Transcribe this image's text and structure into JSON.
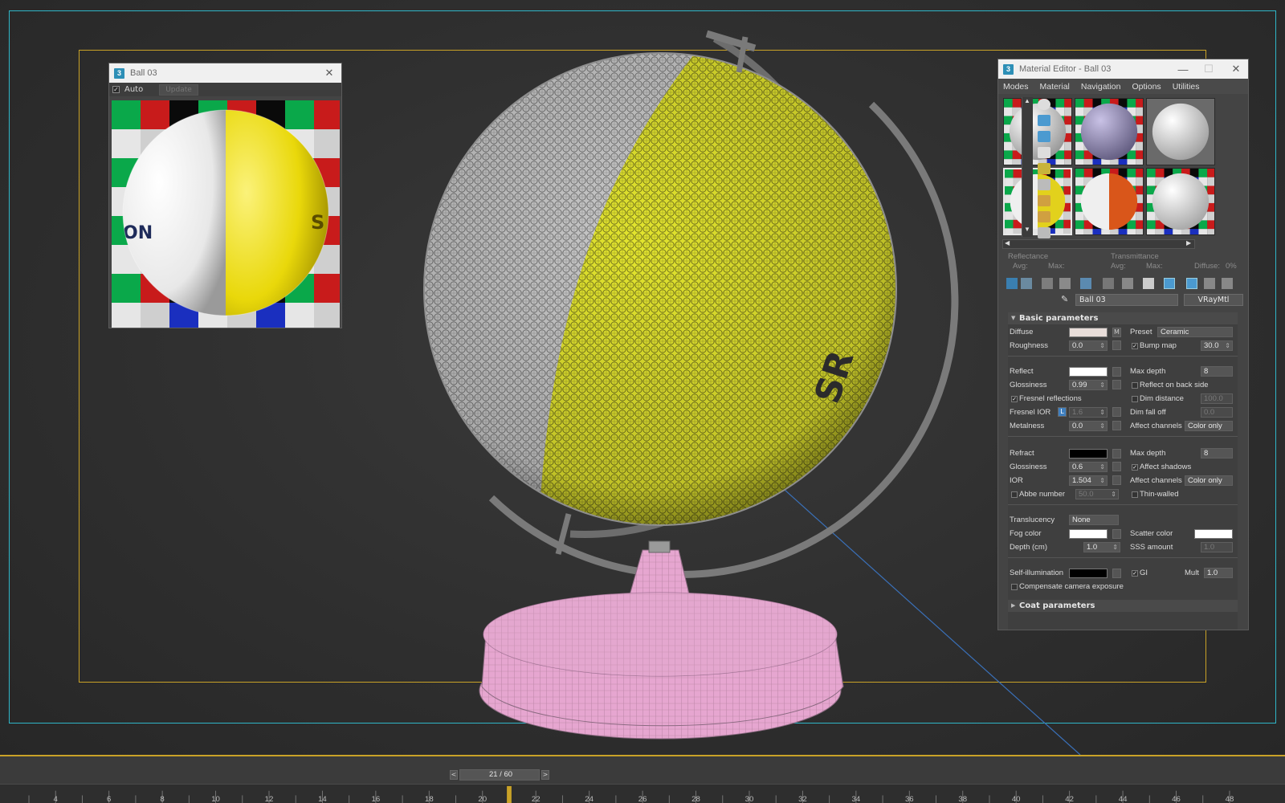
{
  "preview_window": {
    "title": "Ball 03",
    "auto_label": "Auto",
    "auto_checked": true,
    "update_label": "Update"
  },
  "material_editor": {
    "title": "Material Editor - Ball 03",
    "menu": [
      "Modes",
      "Material",
      "Navigation",
      "Options",
      "Utilities"
    ],
    "info": {
      "reflectance": "Reflectance",
      "transmittance": "Transmittance",
      "avg": "Avg:",
      "max": "Max:",
      "diffuse": "Diffuse:",
      "diffuse_value": "0%"
    },
    "material_name": "Ball 03",
    "material_type": "VRayMtl",
    "basic_params_title": "Basic parameters",
    "coat_params_title": "Coat parameters",
    "params": {
      "diffuse": "Diffuse",
      "diffuse_map": "M",
      "preset": "Preset",
      "preset_value": "Ceramic",
      "roughness": "Roughness",
      "roughness_value": "0.0",
      "bump_map": "Bump map",
      "bump_value": "30.0",
      "reflect": "Reflect",
      "max_depth": "Max depth",
      "max_depth_value": "8",
      "glossiness": "Glossiness",
      "glossiness_value": "0.99",
      "reflect_back": "Reflect on back side",
      "fresnel": "Fresnel reflections",
      "dim_distance": "Dim distance",
      "dim_distance_value": "100.0",
      "fresnel_ior": "Fresnel IOR",
      "fresnel_lock": "L",
      "fresnel_ior_value": "1.6",
      "dim_falloff": "Dim fall off",
      "dim_falloff_value": "0.0",
      "metalness": "Metalness",
      "metalness_value": "0.0",
      "affect_channels": "Affect channels",
      "affect_channels_value": "Color only",
      "refract": "Refract",
      "refract_max_depth_value": "8",
      "refr_glossiness_value": "0.6",
      "affect_shadows": "Affect shadows",
      "ior": "IOR",
      "ior_value": "1.504",
      "refr_affect_channels_value": "Color only",
      "abbe": "Abbe number",
      "abbe_value": "50.0",
      "thin_walled": "Thin-walled",
      "translucency": "Translucency",
      "translucency_value": "None",
      "fog_color": "Fog color",
      "scatter_color": "Scatter color",
      "depth": "Depth (cm)",
      "depth_value": "1.0",
      "sss_amount": "SSS amount",
      "sss_value": "1.0",
      "self_illum": "Self-illumination",
      "gi": "GI",
      "mult": "Mult",
      "mult_value": "1.0",
      "compensate": "Compensate camera exposure"
    },
    "colors": {
      "diffuse": "#e8ddd9",
      "reflect": "#ffffff",
      "refract": "#000000",
      "fog": "#ffffff",
      "scatter": "#ffffff",
      "self_illum": "#000000"
    }
  },
  "timeline": {
    "frame_label": "21 / 60",
    "prev": "<",
    "next": ">",
    "ticks": [
      "4",
      "6",
      "8",
      "10",
      "12",
      "14",
      "16",
      "18",
      "20",
      "22",
      "24",
      "26",
      "28",
      "30",
      "32",
      "34",
      "36",
      "38",
      "40",
      "42",
      "44",
      "46",
      "48"
    ],
    "current_frame": 21,
    "total_frames": 60
  },
  "icons": {
    "app": "3ds-max-icon",
    "close": "close-icon",
    "minimize": "minimize-icon",
    "maximize": "maximize-icon"
  },
  "app_icon_text": "3"
}
